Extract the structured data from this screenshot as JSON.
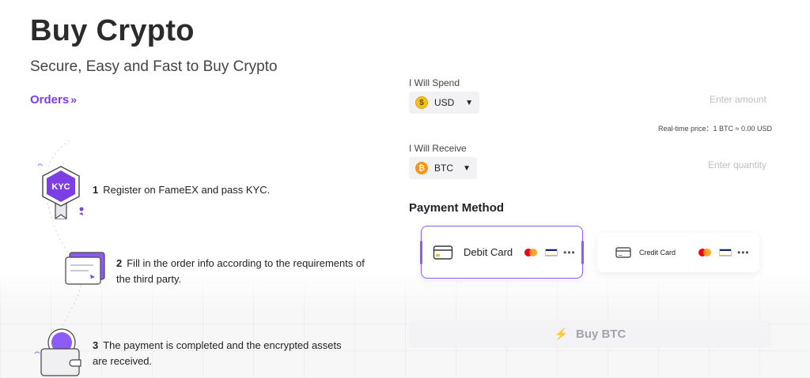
{
  "header": {
    "title": "Buy Crypto",
    "subtitle": "Secure, Easy and Fast to Buy Crypto",
    "orders_link": "Orders",
    "orders_chevron": "»"
  },
  "steps": [
    {
      "num": "1",
      "text": "Register on FameEX and pass KYC.",
      "badge": "KYC"
    },
    {
      "num": "2",
      "text": "Fill in the order info according to the requirements of the third party."
    },
    {
      "num": "3",
      "text": "The payment is completed and the encrypted assets are received."
    }
  ],
  "spend": {
    "label": "I Will Spend",
    "currency": "USD",
    "currency_icon": "$",
    "placeholder": "Enter amount"
  },
  "rate": "Real-time price：1 BTC ≈ 0.00 USD",
  "receive": {
    "label": "I Will Receive",
    "currency": "BTC",
    "currency_icon": "₿",
    "placeholder": "Enter quantity"
  },
  "payment": {
    "title": "Payment Method",
    "methods": [
      {
        "label": "Debit Card",
        "selected": true
      },
      {
        "label": "Credit Card",
        "selected": false
      }
    ],
    "more": "•••"
  },
  "buy_button": {
    "label": "Buy BTC",
    "icon": "lightning-icon"
  },
  "colors": {
    "accent": "#7b3fe4",
    "usd": "#f2c21b",
    "btc": "#f7931a",
    "button_bg": "#f3f3f5"
  }
}
